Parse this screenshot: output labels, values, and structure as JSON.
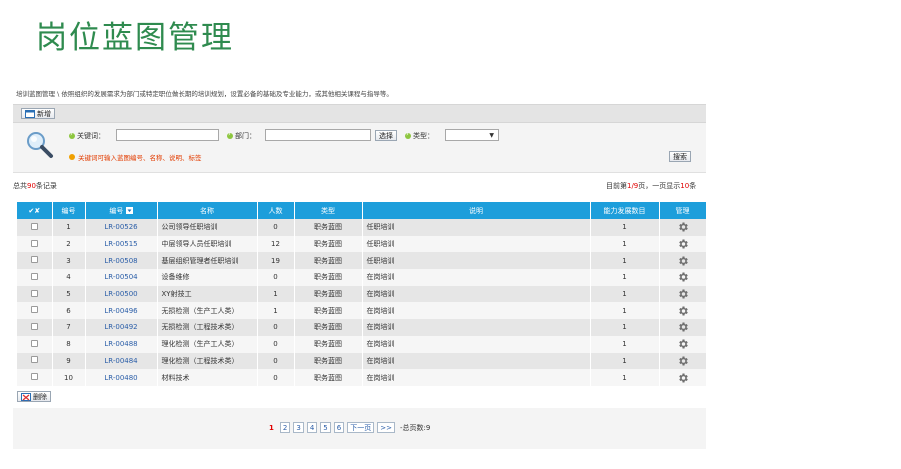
{
  "page_title": "岗位蓝图管理",
  "breadcrumb": "培训蓝图管理 \\ 依照组织的发展需求为部门或特定职位做长期的培训规划，设置必备的基础及专业能力，或其他相关课程与指导等。",
  "toolbar": {
    "new_label": "新增"
  },
  "search": {
    "keyword_label": "关键词：",
    "keyword_value": "",
    "dept_label": "部门：",
    "dept_value": "",
    "select_button": "选择",
    "type_label": "类型：",
    "type_value": "",
    "hint": "关键词可输入蓝图编号、名称、说明、标签",
    "search_button": "搜索"
  },
  "summary": {
    "total_prefix": "总共",
    "total_count": "90",
    "total_suffix": "条记录",
    "page_prefix": "目前第",
    "page_current": "1/9",
    "page_mid": "页，一页显示",
    "page_size": "10",
    "page_suffix": "条"
  },
  "table": {
    "headers": {
      "check": "✔✘",
      "index": "编号",
      "code": "编号",
      "name": "名称",
      "people": "人数",
      "type": "类型",
      "desc": "说明",
      "dev": "能力发展数目",
      "manage": "管理"
    },
    "rows": [
      {
        "index": "1",
        "code": "LR-00526",
        "name": "公司领导任职培训",
        "people": "0",
        "type": "职务蓝图",
        "desc": "任职培训",
        "dev": "1"
      },
      {
        "index": "2",
        "code": "LR-00515",
        "name": "中层领导人员任职培训",
        "people": "12",
        "type": "职务蓝图",
        "desc": "任职培训",
        "dev": "1"
      },
      {
        "index": "3",
        "code": "LR-00508",
        "name": "基层组织管理者任职培训",
        "people": "19",
        "type": "职务蓝图",
        "desc": "任职培训",
        "dev": "1"
      },
      {
        "index": "4",
        "code": "LR-00504",
        "name": "设备维修",
        "people": "0",
        "type": "职务蓝图",
        "desc": "在岗培训",
        "dev": "1"
      },
      {
        "index": "5",
        "code": "LR-00500",
        "name": "XY射技工",
        "people": "1",
        "type": "职务蓝图",
        "desc": "在岗培训",
        "dev": "1"
      },
      {
        "index": "6",
        "code": "LR-00496",
        "name": "无损检测（生产工人类）",
        "people": "1",
        "type": "职务蓝图",
        "desc": "在岗培训",
        "dev": "1"
      },
      {
        "index": "7",
        "code": "LR-00492",
        "name": "无损检测（工程技术类）",
        "people": "0",
        "type": "职务蓝图",
        "desc": "在岗培训",
        "dev": "1"
      },
      {
        "index": "8",
        "code": "LR-00488",
        "name": "理化检测（生产工人类）",
        "people": "0",
        "type": "职务蓝图",
        "desc": "在岗培训",
        "dev": "1"
      },
      {
        "index": "9",
        "code": "LR-00484",
        "name": "理化检测（工程技术类）",
        "people": "0",
        "type": "职务蓝图",
        "desc": "在岗培训",
        "dev": "1"
      },
      {
        "index": "10",
        "code": "LR-00480",
        "name": "材料技术",
        "people": "0",
        "type": "职务蓝图",
        "desc": "在岗培训",
        "dev": "1"
      }
    ]
  },
  "delete_label": "删除",
  "pager": {
    "current": "1",
    "pages": [
      "2",
      "3",
      "4",
      "5",
      "6"
    ],
    "next": "下一页",
    "last": ">>",
    "total": "-总页数:9"
  },
  "colors": {
    "title": "#2f8b4f",
    "header": "#1d9edb",
    "accent_red": "#e00000",
    "link": "#2b5ea8"
  },
  "icons": {
    "search": "magnifier-icon",
    "new": "add-doc-icon",
    "delete": "delete-icon",
    "manage": "gear-icon",
    "sort": "sort-icon"
  }
}
